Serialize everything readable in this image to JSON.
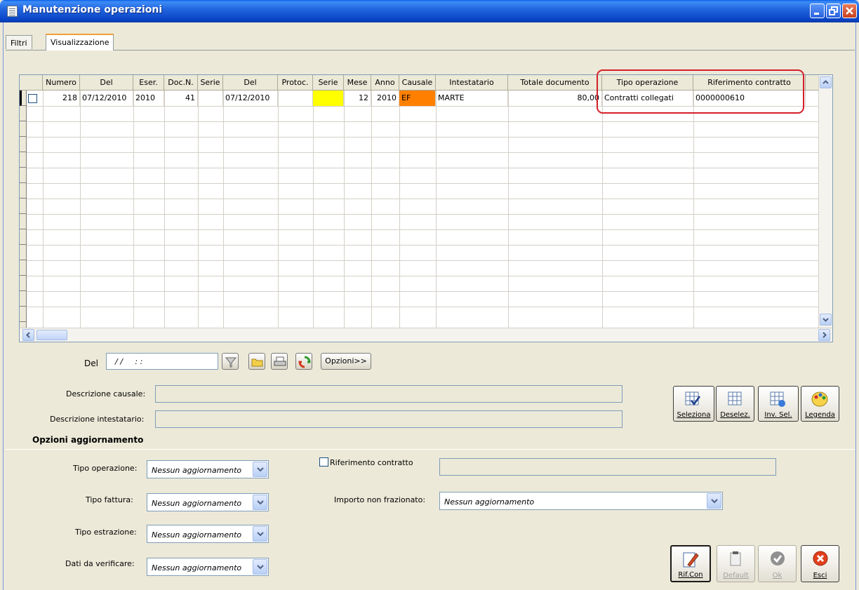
{
  "window": {
    "title": "Manutenzione operazioni"
  },
  "tabs": [
    {
      "label": "Filtri"
    },
    {
      "label": "Visualizzazione"
    }
  ],
  "grid": {
    "columns": [
      "Numero",
      "Del",
      "Eser.",
      "Doc.N.",
      "Serie",
      "Del",
      "Protoc.",
      "Serie",
      "Mese",
      "Anno",
      "Causale",
      "Intestatario",
      "Totale documento",
      "Tipo operazione",
      "Riferimento contratto"
    ],
    "rows": [
      {
        "numero": "218",
        "del": "07/12/2010",
        "eser": "2010",
        "docn": "41",
        "serie": "",
        "del2": "07/12/2010",
        "protoc": "",
        "serie2": "",
        "mese": "12",
        "anno": "2010",
        "causale": "EF",
        "intestatario": "MARTE",
        "totale": "80,00",
        "tipo_operazione": "Contratti collegati",
        "riferimento_contratto": "0000000610"
      }
    ]
  },
  "filter": {
    "del_label": "Del",
    "del_value": "/ /     : :",
    "opzioni_label": "Opzioni>>"
  },
  "descr": {
    "causale_label": "Descrizione causale:",
    "intestatario_label": "Descrizione intestatario:"
  },
  "selection_buttons": {
    "seleziona": "Seleziona",
    "deselez": "Deselez.",
    "invsel": "Inv. Sel.",
    "legenda": "Legenda"
  },
  "options": {
    "title": "Opzioni aggiornamento",
    "tipo_operazione_label": "Tipo operazione:",
    "tipo_fattura_label": "Tipo fattura:",
    "tipo_estrazione_label": "Tipo estrazione:",
    "dati_verificare_label": "Dati da verificare:",
    "combo_value": "Nessun aggiornamento",
    "riferimento_contratto_label": "Riferimento contratto",
    "importo_label": "Importo non frazionato:"
  },
  "action_buttons": {
    "rifcon": "Rif.Con",
    "default": "Default",
    "ok": "Ok",
    "esci": "Esci"
  },
  "colors": {
    "title_bar": "#0a5ee8",
    "highlight": "#d4202a",
    "serie_cell": "#ffff00",
    "causale_cell": "#ff8000"
  }
}
